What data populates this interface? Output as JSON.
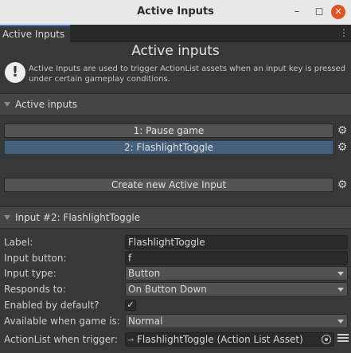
{
  "window": {
    "title": "Active Inputs",
    "minimize_glyph": "–",
    "maximize_glyph": "◻",
    "close_glyph": "✕"
  },
  "tab": {
    "label": "Active Inputs",
    "menu_glyph": "⋮"
  },
  "panel": {
    "title": "Active inputs",
    "info_icon": "!",
    "info_text": "Active Inputs are used to trigger ActionList assets when an input key is pressed under certain gameplay conditions."
  },
  "inputs_section": {
    "header": "Active inputs",
    "items": [
      {
        "label": "1: Pause game",
        "selected": false
      },
      {
        "label": "2: FlashlightToggle",
        "selected": true
      }
    ],
    "create_button": "Create new Active Input"
  },
  "detail_section": {
    "header": "Input #2: FlashlightToggle",
    "fields": {
      "label": {
        "label": "Label:",
        "value": "FlashlightToggle"
      },
      "input_button": {
        "label": "Input button:",
        "value": "f"
      },
      "input_type": {
        "label": "Input type:",
        "value": "Button"
      },
      "responds_to": {
        "label": "Responds to:",
        "value": "On Button Down"
      },
      "enabled_by_default": {
        "label": "Enabled by default?",
        "checked": true,
        "glyph": "✓"
      },
      "available_when": {
        "label": "Available when game is:",
        "value": "Normal"
      },
      "actionlist": {
        "label": "ActionList when trigger:",
        "value": "FlashlightToggle (Action List Asset)"
      }
    }
  },
  "icons": {
    "gear": "gear-icon",
    "asset": "actionlist-asset-icon",
    "picker": "object-picker-icon",
    "list": "list-icon"
  },
  "colors": {
    "background": "#383838",
    "selected_item": "#46607c",
    "tab_accent": "#3a79bb",
    "close_button": "#e0551f"
  }
}
